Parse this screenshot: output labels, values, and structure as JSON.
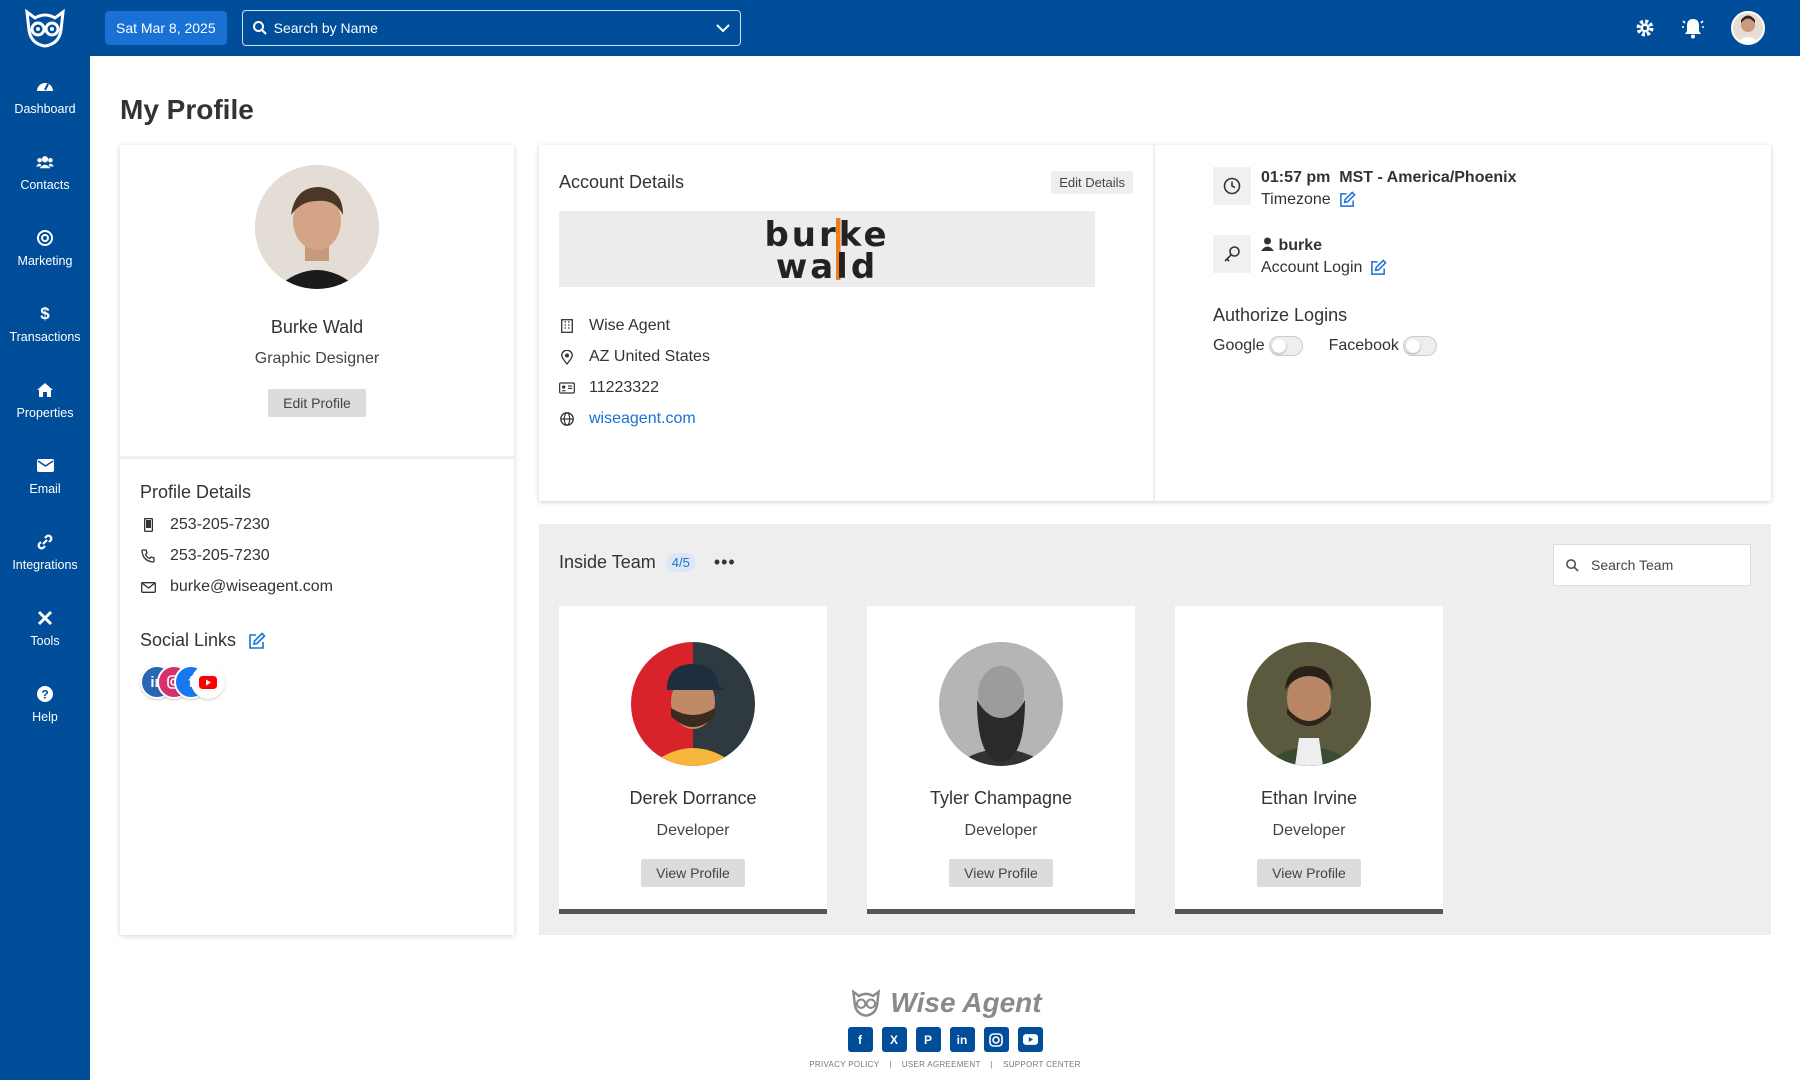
{
  "topbar": {
    "date": "Sat Mar 8, 2025",
    "search_placeholder": "Search by Name"
  },
  "sidebar": {
    "items": [
      {
        "label": "Dashboard",
        "icon": "gauge-icon"
      },
      {
        "label": "Contacts",
        "icon": "users-icon"
      },
      {
        "label": "Marketing",
        "icon": "target-icon"
      },
      {
        "label": "Transactions",
        "icon": "dollar-icon"
      },
      {
        "label": "Properties",
        "icon": "home-icon"
      },
      {
        "label": "Email",
        "icon": "envelope-icon"
      },
      {
        "label": "Integrations",
        "icon": "link-icon"
      },
      {
        "label": "Tools",
        "icon": "tools-icon"
      },
      {
        "label": "Help",
        "icon": "question-icon"
      }
    ]
  },
  "page": {
    "title": "My Profile"
  },
  "profile": {
    "name": "Burke Wald",
    "role": "Graphic Designer",
    "edit_label": "Edit Profile",
    "details_title": "Profile Details",
    "mobile": "253-205-7230",
    "phone": "253-205-7230",
    "email": "burke@wiseagent.com",
    "social_title": "Social Links",
    "social": [
      "linkedin",
      "instagram",
      "facebook",
      "youtube"
    ]
  },
  "account": {
    "title": "Account Details",
    "edit_label": "Edit Details",
    "logo_line1": "burke",
    "logo_line2": "wald",
    "company": "Wise Agent",
    "location": "AZ United States",
    "license": "11223322",
    "website": "wiseagent.com",
    "time": "01:57 pm",
    "timezone_name": "MST - America/Phoenix",
    "timezone_label": "Timezone",
    "login_user": "burke",
    "login_label": "Account Login",
    "authorize_title": "Authorize Logins",
    "google": "Google",
    "facebook": "Facebook",
    "google_enabled": false,
    "facebook_enabled": false
  },
  "team": {
    "title": "Inside Team",
    "count": "4/5",
    "menu": "•••",
    "search_placeholder": "Search Team",
    "members": [
      {
        "name": "Derek Dorrance",
        "role": "Developer",
        "button": "View Profile"
      },
      {
        "name": "Tyler Champagne",
        "role": "Developer",
        "button": "View Profile"
      },
      {
        "name": "Ethan Irvine",
        "role": "Developer",
        "button": "View Profile"
      }
    ]
  },
  "footer": {
    "brand": "Wise Agent",
    "links": [
      "PRIVACY POLICY",
      "|",
      "USER AGREEMENT",
      "|",
      "SUPPORT CENTER"
    ],
    "social": [
      "facebook",
      "x",
      "pinterest",
      "linkedin",
      "instagram",
      "youtube"
    ]
  },
  "colors": {
    "nav": "#004d99",
    "accent": "#1971d6",
    "link": "#1971d6"
  }
}
